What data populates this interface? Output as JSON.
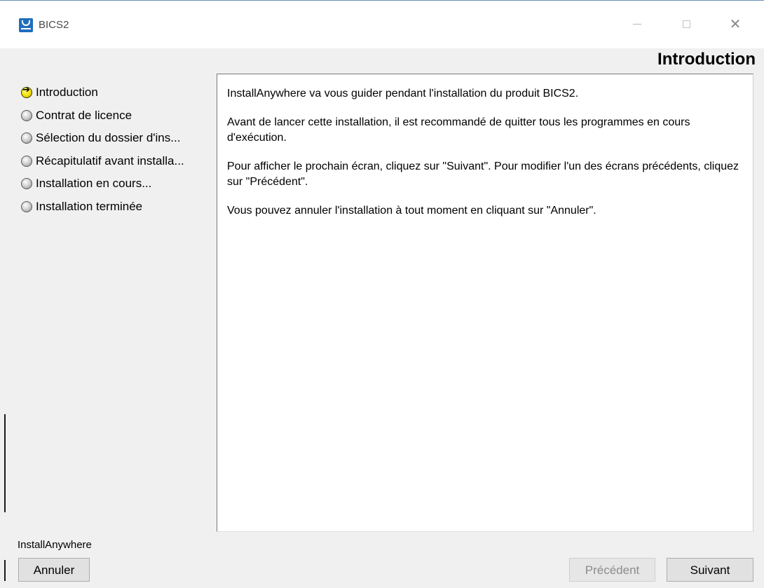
{
  "window": {
    "title": "BICS2",
    "icon": "app-logo-icon",
    "minimize_icon": "minimize-icon",
    "maximize_icon": "maximize-icon",
    "close_glyph": "✕"
  },
  "header": {
    "title": "Introduction"
  },
  "steps": [
    {
      "label": "Introduction",
      "current": true
    },
    {
      "label": "Contrat de licence",
      "current": false
    },
    {
      "label": "Sélection du dossier d'ins...",
      "current": false
    },
    {
      "label": "Récapitulatif avant installa...",
      "current": false
    },
    {
      "label": "Installation en cours...",
      "current": false
    },
    {
      "label": "Installation terminée",
      "current": false
    }
  ],
  "content": {
    "paragraphs": [
      "InstallAnywhere va vous guider pendant l'installation du produit BICS2.",
      "Avant de lancer cette installation, il est recommandé de quitter tous les programmes en cours d'exécution.",
      "Pour afficher le prochain écran, cliquez sur \"Suivant\". Pour modifier l'un des écrans précédents, cliquez sur \"Précédent\".",
      "Vous pouvez annuler l'installation à tout moment en cliquant sur \"Annuler\"."
    ]
  },
  "footer": {
    "brand": "InstallAnywhere",
    "cancel_label": "Annuler",
    "previous_label": "Précédent",
    "next_label": "Suivant",
    "previous_enabled": false
  }
}
